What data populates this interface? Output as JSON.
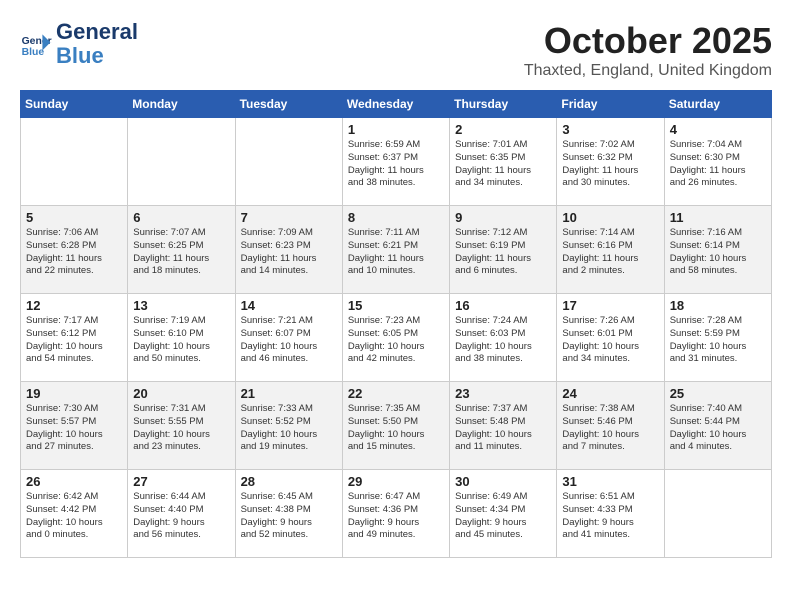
{
  "header": {
    "logo_line1": "General",
    "logo_line2": "Blue",
    "month": "October 2025",
    "location": "Thaxted, England, United Kingdom"
  },
  "weekdays": [
    "Sunday",
    "Monday",
    "Tuesday",
    "Wednesday",
    "Thursday",
    "Friday",
    "Saturday"
  ],
  "weeks": [
    [
      {
        "day": "",
        "text": ""
      },
      {
        "day": "",
        "text": ""
      },
      {
        "day": "",
        "text": ""
      },
      {
        "day": "1",
        "text": "Sunrise: 6:59 AM\nSunset: 6:37 PM\nDaylight: 11 hours\nand 38 minutes."
      },
      {
        "day": "2",
        "text": "Sunrise: 7:01 AM\nSunset: 6:35 PM\nDaylight: 11 hours\nand 34 minutes."
      },
      {
        "day": "3",
        "text": "Sunrise: 7:02 AM\nSunset: 6:32 PM\nDaylight: 11 hours\nand 30 minutes."
      },
      {
        "day": "4",
        "text": "Sunrise: 7:04 AM\nSunset: 6:30 PM\nDaylight: 11 hours\nand 26 minutes."
      }
    ],
    [
      {
        "day": "5",
        "text": "Sunrise: 7:06 AM\nSunset: 6:28 PM\nDaylight: 11 hours\nand 22 minutes."
      },
      {
        "day": "6",
        "text": "Sunrise: 7:07 AM\nSunset: 6:25 PM\nDaylight: 11 hours\nand 18 minutes."
      },
      {
        "day": "7",
        "text": "Sunrise: 7:09 AM\nSunset: 6:23 PM\nDaylight: 11 hours\nand 14 minutes."
      },
      {
        "day": "8",
        "text": "Sunrise: 7:11 AM\nSunset: 6:21 PM\nDaylight: 11 hours\nand 10 minutes."
      },
      {
        "day": "9",
        "text": "Sunrise: 7:12 AM\nSunset: 6:19 PM\nDaylight: 11 hours\nand 6 minutes."
      },
      {
        "day": "10",
        "text": "Sunrise: 7:14 AM\nSunset: 6:16 PM\nDaylight: 11 hours\nand 2 minutes."
      },
      {
        "day": "11",
        "text": "Sunrise: 7:16 AM\nSunset: 6:14 PM\nDaylight: 10 hours\nand 58 minutes."
      }
    ],
    [
      {
        "day": "12",
        "text": "Sunrise: 7:17 AM\nSunset: 6:12 PM\nDaylight: 10 hours\nand 54 minutes."
      },
      {
        "day": "13",
        "text": "Sunrise: 7:19 AM\nSunset: 6:10 PM\nDaylight: 10 hours\nand 50 minutes."
      },
      {
        "day": "14",
        "text": "Sunrise: 7:21 AM\nSunset: 6:07 PM\nDaylight: 10 hours\nand 46 minutes."
      },
      {
        "day": "15",
        "text": "Sunrise: 7:23 AM\nSunset: 6:05 PM\nDaylight: 10 hours\nand 42 minutes."
      },
      {
        "day": "16",
        "text": "Sunrise: 7:24 AM\nSunset: 6:03 PM\nDaylight: 10 hours\nand 38 minutes."
      },
      {
        "day": "17",
        "text": "Sunrise: 7:26 AM\nSunset: 6:01 PM\nDaylight: 10 hours\nand 34 minutes."
      },
      {
        "day": "18",
        "text": "Sunrise: 7:28 AM\nSunset: 5:59 PM\nDaylight: 10 hours\nand 31 minutes."
      }
    ],
    [
      {
        "day": "19",
        "text": "Sunrise: 7:30 AM\nSunset: 5:57 PM\nDaylight: 10 hours\nand 27 minutes."
      },
      {
        "day": "20",
        "text": "Sunrise: 7:31 AM\nSunset: 5:55 PM\nDaylight: 10 hours\nand 23 minutes."
      },
      {
        "day": "21",
        "text": "Sunrise: 7:33 AM\nSunset: 5:52 PM\nDaylight: 10 hours\nand 19 minutes."
      },
      {
        "day": "22",
        "text": "Sunrise: 7:35 AM\nSunset: 5:50 PM\nDaylight: 10 hours\nand 15 minutes."
      },
      {
        "day": "23",
        "text": "Sunrise: 7:37 AM\nSunset: 5:48 PM\nDaylight: 10 hours\nand 11 minutes."
      },
      {
        "day": "24",
        "text": "Sunrise: 7:38 AM\nSunset: 5:46 PM\nDaylight: 10 hours\nand 7 minutes."
      },
      {
        "day": "25",
        "text": "Sunrise: 7:40 AM\nSunset: 5:44 PM\nDaylight: 10 hours\nand 4 minutes."
      }
    ],
    [
      {
        "day": "26",
        "text": "Sunrise: 6:42 AM\nSunset: 4:42 PM\nDaylight: 10 hours\nand 0 minutes."
      },
      {
        "day": "27",
        "text": "Sunrise: 6:44 AM\nSunset: 4:40 PM\nDaylight: 9 hours\nand 56 minutes."
      },
      {
        "day": "28",
        "text": "Sunrise: 6:45 AM\nSunset: 4:38 PM\nDaylight: 9 hours\nand 52 minutes."
      },
      {
        "day": "29",
        "text": "Sunrise: 6:47 AM\nSunset: 4:36 PM\nDaylight: 9 hours\nand 49 minutes."
      },
      {
        "day": "30",
        "text": "Sunrise: 6:49 AM\nSunset: 4:34 PM\nDaylight: 9 hours\nand 45 minutes."
      },
      {
        "day": "31",
        "text": "Sunrise: 6:51 AM\nSunset: 4:33 PM\nDaylight: 9 hours\nand 41 minutes."
      },
      {
        "day": "",
        "text": ""
      }
    ]
  ]
}
